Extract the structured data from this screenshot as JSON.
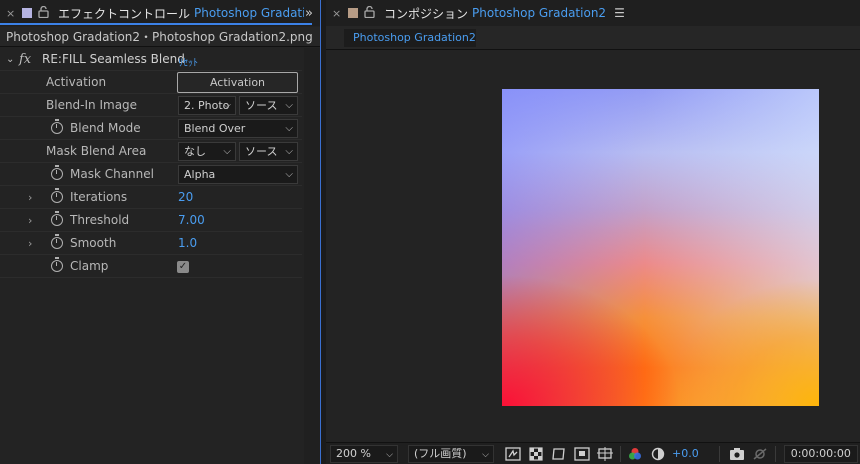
{
  "effects_panel": {
    "close": "×",
    "lock": "🔓",
    "title": "エフェクトコントロール",
    "subtitle": "Photoshop Gradation",
    "expand": "»",
    "path": "Photoshop Gradation2・Photoshop Gradation2.png",
    "effect": {
      "fx": "fx",
      "name": "RE:FILL Seamless Blend",
      "reset": "ﾘｾｯﾄ"
    },
    "properties": {
      "activation": {
        "label": "Activation",
        "button": "Activation"
      },
      "blend_in_image": {
        "label": "Blend-In Image",
        "layer": "2. Photo",
        "source": "ソース"
      },
      "blend_mode": {
        "label": "Blend Mode",
        "value": "Blend Over"
      },
      "mask_blend_area": {
        "label": "Mask Blend Area",
        "layer": "なし",
        "source": "ソース"
      },
      "mask_channel": {
        "label": "Mask Channel",
        "value": "Alpha"
      },
      "iterations": {
        "label": "Iterations",
        "value": "20"
      },
      "threshold": {
        "label": "Threshold",
        "value": "7.00"
      },
      "smooth": {
        "label": "Smooth",
        "value": "1.0"
      },
      "clamp": {
        "label": "Clamp",
        "checked": "✓"
      }
    }
  },
  "comp_panel": {
    "close": "×",
    "lock": "🔓",
    "title": "コンポジション",
    "subtitle": "Photoshop Gradation2",
    "menu": "☰",
    "tab": "Photoshop Gradation2"
  },
  "bottom_bar": {
    "zoom": "200 %",
    "quality": "(フル画質)",
    "exposure": "+0.0",
    "timecode": "0:00:00:00"
  },
  "colors": {
    "accent": "#4a9df0",
    "panel_focus": "#3c82e8",
    "effects_swatch": "#b6b4e2",
    "comp_swatch": "#b79c86"
  }
}
